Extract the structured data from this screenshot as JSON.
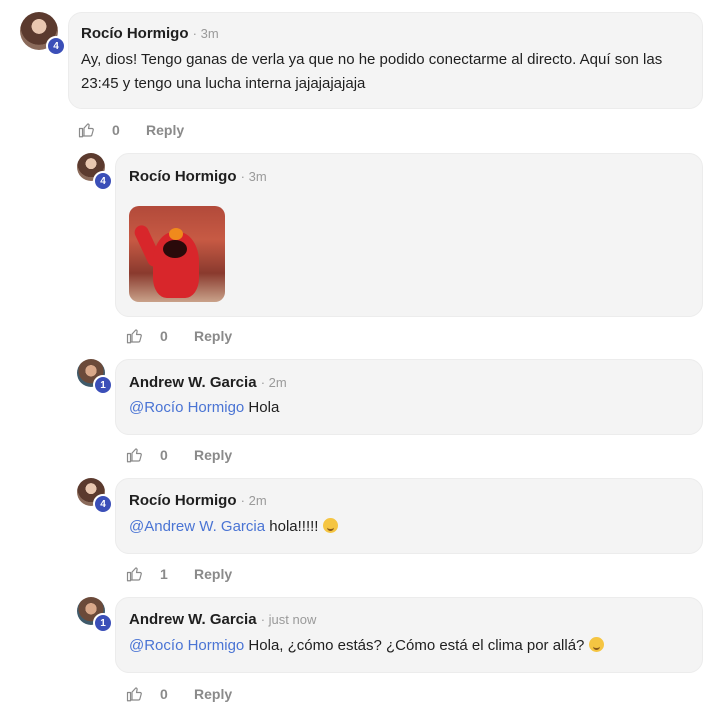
{
  "comments": [
    {
      "author": "Rocío Hormigo",
      "time": "· 3m",
      "badge": "4",
      "text": "Ay, dios! Tengo ganas de verla ya que no he podido conectarme al directo. Aquí son las 23:45 y tengo una lucha interna jajajajajaja",
      "likes": "0",
      "reply_label": "Reply"
    },
    {
      "author": "Rocío Hormigo",
      "time": "· 3m",
      "badge": "4",
      "media": "elmo-gif",
      "likes": "0",
      "reply_label": "Reply"
    },
    {
      "author": "Andrew W. Garcia",
      "time": "· 2m",
      "badge": "1",
      "mention": "@Rocío Hormigo",
      "text": " Hola",
      "likes": "0",
      "reply_label": "Reply"
    },
    {
      "author": "Rocío Hormigo",
      "time": "· 2m",
      "badge": "4",
      "mention": "@Andrew W. Garcia",
      "text": " hola!!!!! ",
      "emoji": "relieved-emoji",
      "likes": "1",
      "reply_label": "Reply"
    },
    {
      "author": "Andrew W. Garcia",
      "time": "· just now",
      "badge": "1",
      "mention": "@Rocío Hormigo",
      "text": " Hola, ¿cómo estás? ¿Cómo está el clima por allá? ",
      "emoji": "smile-emoji",
      "likes": "0",
      "reply_label": "Reply"
    }
  ],
  "icons": {
    "like": "thumbs-up-icon"
  },
  "colors": {
    "mention": "#4a74d4",
    "badge": "#3b4fb8",
    "bubble": "#f4f4f4"
  }
}
